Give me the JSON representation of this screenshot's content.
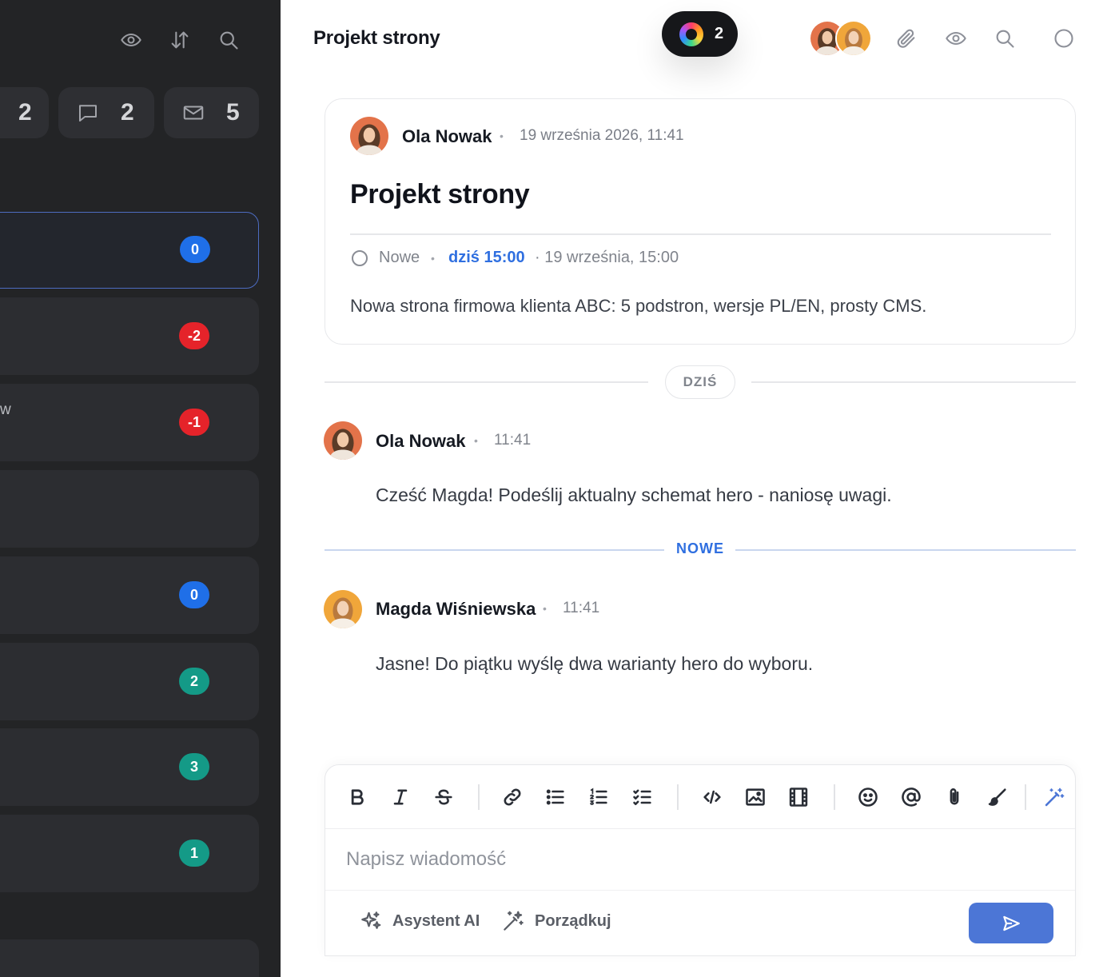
{
  "sidebar": {
    "stats": [
      {
        "icon": "checkbox-icon",
        "value": "2"
      },
      {
        "icon": "chat-icon",
        "value": "2"
      },
      {
        "icon": "mail-icon",
        "value": "5"
      }
    ],
    "cards": [
      {
        "badge": "0",
        "color": "#1f6fe8",
        "active": true,
        "text": ""
      },
      {
        "badge": "-2",
        "color": "#e5232a",
        "text": ""
      },
      {
        "badge": "-1",
        "color": "#e5232a",
        "text": "w"
      },
      {
        "badge": "",
        "color": "",
        "text": ""
      },
      {
        "badge": "0",
        "color": "#1f6fe8",
        "text": ""
      },
      {
        "badge": "2",
        "color": "#149a87",
        "text": ""
      },
      {
        "badge": "3",
        "color": "#149a87",
        "text": ""
      },
      {
        "badge": "1",
        "color": "#149a87",
        "text": ""
      }
    ]
  },
  "header": {
    "title": "Projekt strony",
    "presence_count": "2"
  },
  "task": {
    "author": "Ola Nowak",
    "date": "19 września 2026, 11:41",
    "title": "Projekt strony",
    "status": "Nowe",
    "due": "dziś 15:00",
    "due_full": "· 19 września, 15:00",
    "description": "Nowa strona firmowa klienta ABC: 5 podstron, wersje PL/EN, prosty CMS."
  },
  "dividers": {
    "today": "DZIŚ",
    "new": "NOWE"
  },
  "messages": [
    {
      "author": "Ola Nowak",
      "time": "11:41",
      "text": "Cześć Magda! Podeślij aktualny schemat hero - naniosę uwagi."
    },
    {
      "author": "Magda Wiśniewska",
      "time": "11:41",
      "text": "Jasne! Do piątku wyślę dwa warianty hero do wyboru."
    }
  ],
  "composer": {
    "placeholder": "Napisz wiadomość",
    "ai_assistant": "Asystent AI",
    "tidy": "Porządkuj"
  },
  "colors": {
    "accent": "#2f6fe0",
    "send": "#4c76d6",
    "sidebar_bg": "#232426"
  }
}
